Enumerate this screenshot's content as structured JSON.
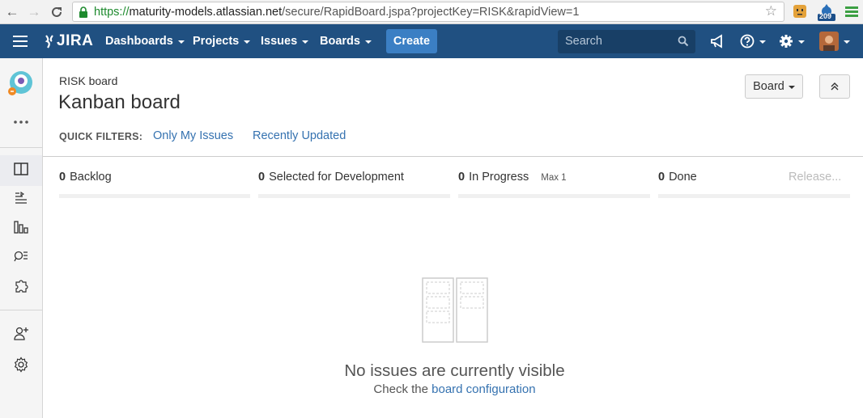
{
  "browser": {
    "url_scheme": "https://",
    "url_host": "maturity-models.atlassian.net",
    "url_path": "/secure/RapidBoard.jspa?projectKey=RISK&rapidView=1",
    "extension_badge": "209"
  },
  "header": {
    "logo_text": "JIRA",
    "nav": [
      "Dashboards",
      "Projects",
      "Issues",
      "Boards"
    ],
    "create_label": "Create",
    "search_placeholder": "Search",
    "bg_color": "#205081",
    "accent_color": "#3b7fc4"
  },
  "page": {
    "breadcrumb": "RISK board",
    "title": "Kanban board",
    "board_button": "Board",
    "quick_filters_label": "QUICK FILTERS:",
    "quick_filters": [
      "Only My Issues",
      "Recently Updated"
    ]
  },
  "columns": [
    {
      "count": "0",
      "name": "Backlog",
      "max": ""
    },
    {
      "count": "0",
      "name": "Selected for Development",
      "max": ""
    },
    {
      "count": "0",
      "name": "In Progress",
      "max": "Max 1"
    },
    {
      "count": "0",
      "name": "Done",
      "max": ""
    }
  ],
  "release_label": "Release...",
  "empty_state": {
    "title": "No issues are currently visible",
    "sub_prefix": "Check the",
    "sub_link": "board configuration"
  }
}
